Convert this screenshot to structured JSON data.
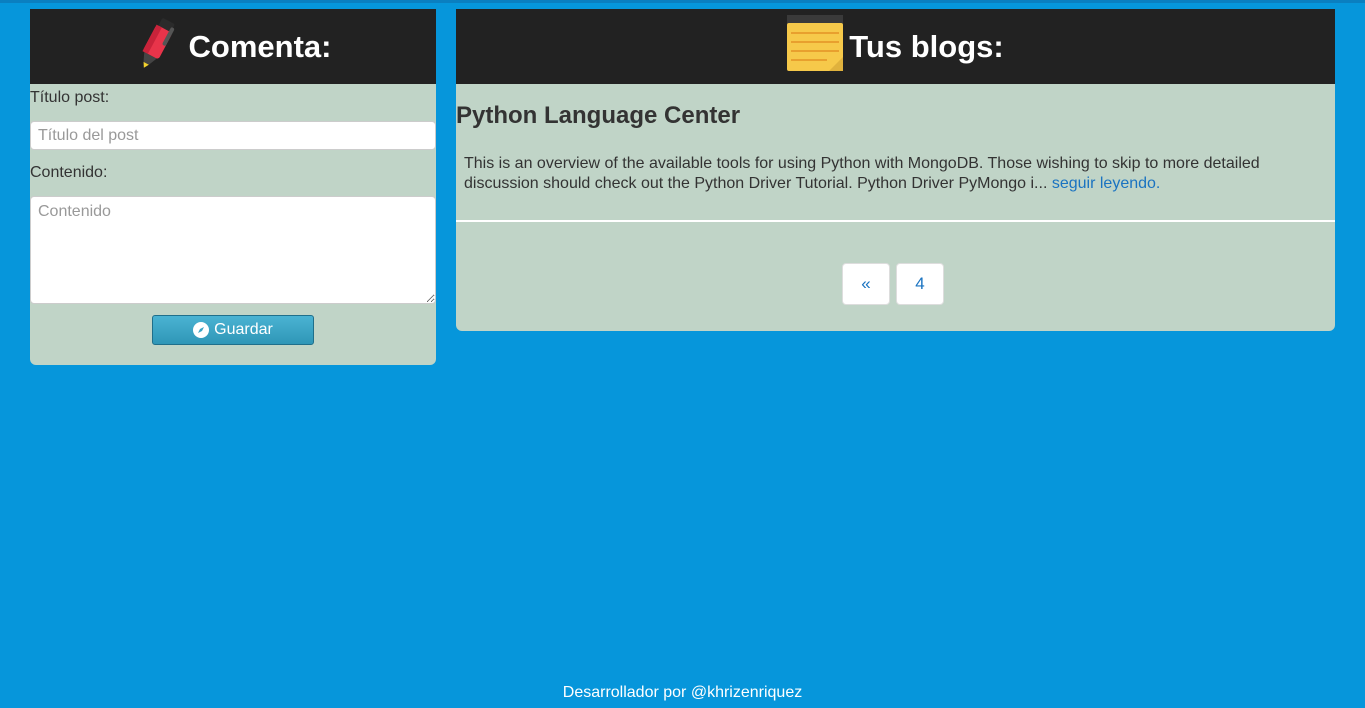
{
  "comment_panel": {
    "heading": "Comenta:",
    "icon": "marker-pen-icon",
    "title_label": "Título post:",
    "title_placeholder": "Título del post",
    "content_label": "Contenido:",
    "content_placeholder": "Contenido",
    "save_label": "Guardar",
    "save_icon": "compass-icon"
  },
  "blogs_panel": {
    "heading": "Tus blogs:",
    "icon": "notepad-icon",
    "posts": [
      {
        "title": "Python Language Center",
        "excerpt": "This is an overview of the available tools for using Python with MongoDB. Those wishing to skip to more detailed discussion should check out the Python Driver Tutorial. Python Driver PyMongo i...",
        "read_more": "seguir leyendo."
      }
    ],
    "pagination": {
      "prev": "«",
      "current": "4"
    }
  },
  "footer": {
    "text": "Desarrollador por @khrizenriquez"
  },
  "colors": {
    "background": "#0696db",
    "panel": "#c0d4c7",
    "header": "#222222",
    "link": "#1a73c1",
    "button": "#3aa3c4"
  }
}
